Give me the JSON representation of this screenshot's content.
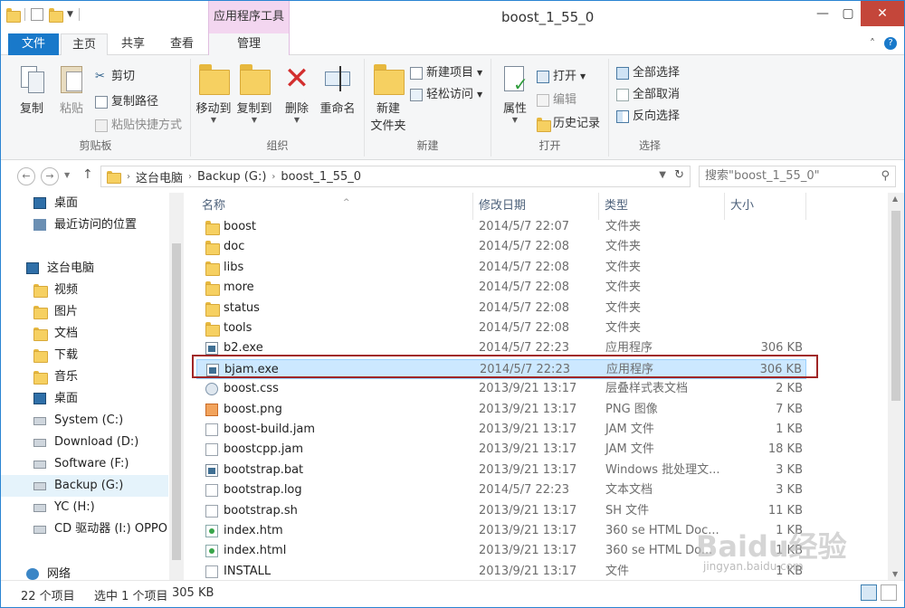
{
  "window": {
    "title": "boost_1_55_0",
    "context_tab_group": "应用程序工具"
  },
  "tabs": {
    "file": "文件",
    "home": "主页",
    "share": "共享",
    "view": "查看",
    "manage": "管理"
  },
  "ribbon": {
    "clipboard": {
      "label": "剪贴板",
      "copy": "复制",
      "paste": "粘贴",
      "cut": "剪切",
      "copy_path": "复制路径",
      "paste_shortcut": "粘贴快捷方式"
    },
    "organize": {
      "label": "组织",
      "move_to": "移动到",
      "copy_to": "复制到",
      "delete": "删除",
      "rename": "重命名"
    },
    "new": {
      "label": "新建",
      "new_folder_line1": "新建",
      "new_folder_line2": "文件夹",
      "new_item": "新建项目",
      "easy_access": "轻松访问"
    },
    "open": {
      "label": "打开",
      "properties": "属性",
      "open": "打开",
      "edit": "编辑",
      "history": "历史记录"
    },
    "select": {
      "label": "选择",
      "select_all": "全部选择",
      "select_none": "全部取消",
      "invert": "反向选择"
    }
  },
  "address": {
    "crumbs": [
      "这台电脑",
      "Backup (G:)",
      "boost_1_55_0"
    ],
    "search_placeholder": "搜索\"boost_1_55_0\""
  },
  "nav": {
    "favorites": [
      {
        "label": "桌面",
        "icon": "desktop-icon"
      },
      {
        "label": "最近访问的位置",
        "icon": "recent-icon"
      }
    ],
    "this_pc": "这台电脑",
    "pc_items": [
      {
        "label": "视频",
        "icon": "videos-icon"
      },
      {
        "label": "图片",
        "icon": "pictures-icon"
      },
      {
        "label": "文档",
        "icon": "documents-icon"
      },
      {
        "label": "下载",
        "icon": "downloads-icon"
      },
      {
        "label": "音乐",
        "icon": "music-icon"
      },
      {
        "label": "桌面",
        "icon": "desktop-icon"
      },
      {
        "label": "System (C:)",
        "icon": "drive-icon"
      },
      {
        "label": "Download (D:)",
        "icon": "drive-icon"
      },
      {
        "label": "Software (F:)",
        "icon": "drive-icon"
      },
      {
        "label": "Backup (G:)",
        "icon": "drive-icon"
      },
      {
        "label": "YC (H:)",
        "icon": "drive-icon"
      },
      {
        "label": "CD 驱动器 (I:) OPPO",
        "icon": "cd-drive-icon"
      }
    ],
    "network": "网络"
  },
  "columns": {
    "name": "名称",
    "date": "修改日期",
    "type": "类型",
    "size": "大小"
  },
  "files": [
    {
      "name": "boost",
      "date": "2014/5/7 22:07",
      "type": "文件夹",
      "size": "",
      "icon": "folder"
    },
    {
      "name": "doc",
      "date": "2014/5/7 22:08",
      "type": "文件夹",
      "size": "",
      "icon": "folder"
    },
    {
      "name": "libs",
      "date": "2014/5/7 22:08",
      "type": "文件夹",
      "size": "",
      "icon": "folder"
    },
    {
      "name": "more",
      "date": "2014/5/7 22:08",
      "type": "文件夹",
      "size": "",
      "icon": "folder"
    },
    {
      "name": "status",
      "date": "2014/5/7 22:08",
      "type": "文件夹",
      "size": "",
      "icon": "folder"
    },
    {
      "name": "tools",
      "date": "2014/5/7 22:08",
      "type": "文件夹",
      "size": "",
      "icon": "folder"
    },
    {
      "name": "b2.exe",
      "date": "2014/5/7 22:23",
      "type": "应用程序",
      "size": "306 KB",
      "icon": "exe"
    },
    {
      "name": "bjam.exe",
      "date": "2014/5/7 22:23",
      "type": "应用程序",
      "size": "306 KB",
      "icon": "exe",
      "selected": true
    },
    {
      "name": "boost.css",
      "date": "2013/9/21 13:17",
      "type": "层叠样式表文档",
      "size": "2 KB",
      "icon": "css"
    },
    {
      "name": "boost.png",
      "date": "2013/9/21 13:17",
      "type": "PNG 图像",
      "size": "7 KB",
      "icon": "png"
    },
    {
      "name": "boost-build.jam",
      "date": "2013/9/21 13:17",
      "type": "JAM 文件",
      "size": "1 KB",
      "icon": "doc"
    },
    {
      "name": "boostcpp.jam",
      "date": "2013/9/21 13:17",
      "type": "JAM 文件",
      "size": "18 KB",
      "icon": "doc"
    },
    {
      "name": "bootstrap.bat",
      "date": "2013/9/21 13:17",
      "type": "Windows 批处理文...",
      "size": "3 KB",
      "icon": "exe"
    },
    {
      "name": "bootstrap.log",
      "date": "2014/5/7 22:23",
      "type": "文本文档",
      "size": "3 KB",
      "icon": "doc"
    },
    {
      "name": "bootstrap.sh",
      "date": "2013/9/21 13:17",
      "type": "SH 文件",
      "size": "11 KB",
      "icon": "doc"
    },
    {
      "name": "index.htm",
      "date": "2013/9/21 13:17",
      "type": "360 se HTML Doc...",
      "size": "1 KB",
      "icon": "html"
    },
    {
      "name": "index.html",
      "date": "2013/9/21 13:17",
      "type": "360 se HTML Do...",
      "size": "1 KB",
      "icon": "html"
    },
    {
      "name": "INSTALL",
      "date": "2013/9/21 13:17",
      "type": "文件",
      "size": "1 KB",
      "icon": "doc"
    }
  ],
  "status": {
    "count": "22 个项目",
    "selection": "选中 1 个项目",
    "selection_size": "305 KB"
  },
  "watermark": {
    "main": "Baidu经验",
    "sub": "jingyan.baidu.com"
  }
}
